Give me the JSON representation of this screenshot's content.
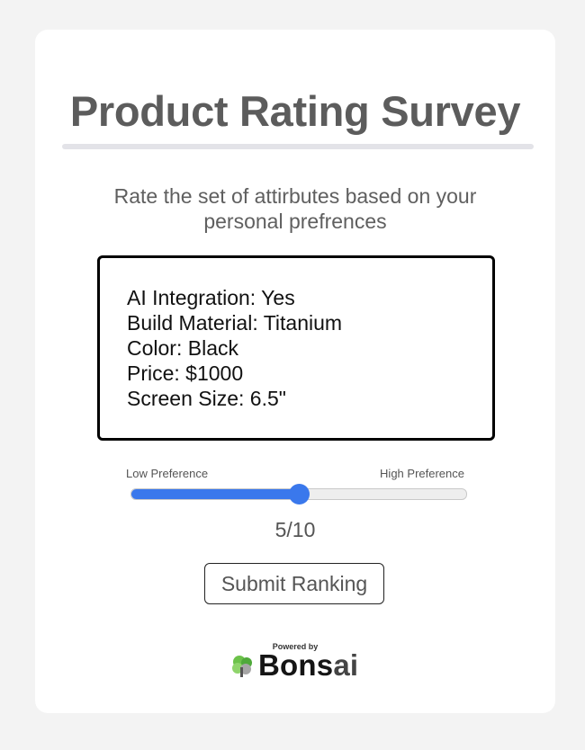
{
  "survey": {
    "title": "Product Rating Survey",
    "subtitle": "Rate the set of attirbutes based on your personal prefrences"
  },
  "attributes": [
    "AI Integration: Yes",
    "Build Material: Titanium",
    "Color: Black",
    "Price: $1000",
    "Screen Size: 6.5\""
  ],
  "slider": {
    "low_label": "Low Preference",
    "high_label": "High Preference",
    "value": 5,
    "max": 10,
    "value_text": "5/10",
    "accent_color": "#3a78ec"
  },
  "submit": {
    "label": "Submit Ranking"
  },
  "footer": {
    "powered_by": "Powered by",
    "brand_main": "Bons",
    "brand_tail": "ai",
    "logo_icon": "bonsai-tree-icon"
  }
}
